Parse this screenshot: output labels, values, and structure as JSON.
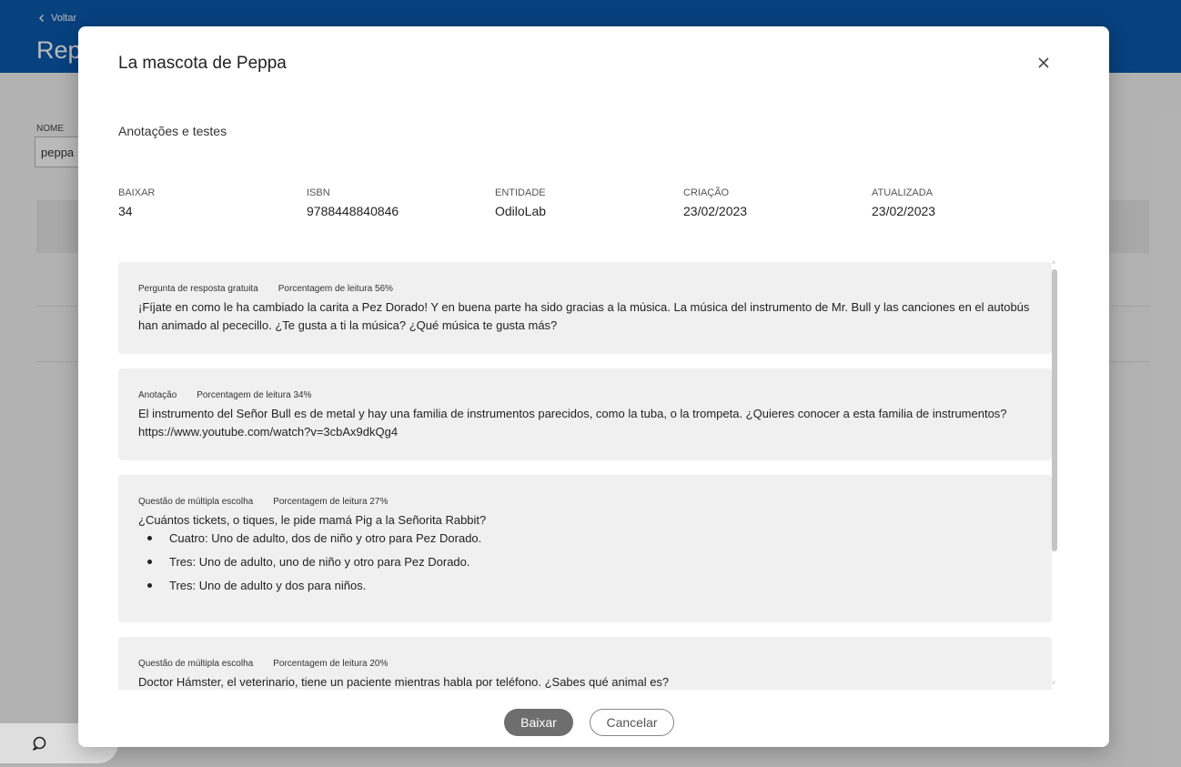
{
  "background": {
    "back_label": "Voltar",
    "page_title": "Rep",
    "name_label": "NOME",
    "name_value": "peppa"
  },
  "modal": {
    "title": "La mascota de Peppa",
    "section_title": "Anotações e testes",
    "meta": [
      {
        "label": "BAIXAR",
        "value": "34"
      },
      {
        "label": "ISBN",
        "value": "9788448840846"
      },
      {
        "label": "ENTIDADE",
        "value": "OdiloLab"
      },
      {
        "label": "CRIAÇÃO",
        "value": "23/02/2023"
      },
      {
        "label": "ATUALIZADA",
        "value": "23/02/2023"
      }
    ],
    "cards": [
      {
        "type": "Pergunta de resposta gratuita",
        "progress": "Porcentagem de leitura 56%",
        "text": "¡Fíjate en como le ha cambiado la carita a Pez Dorado! Y en buena parte ha sido gracias a la música. La música del instrumento de Mr. Bull y las canciones en el autobús han animado al pececillo. ¿Te gusta a ti la música? ¿Qué música te gusta más?"
      },
      {
        "type": "Anotação",
        "progress": "Porcentagem de leitura 34%",
        "text": "El instrumento del Señor Bull es de metal y hay una familia de instrumentos parecidos, como la tuba, o la trompeta. ¿Quieres conocer a esta familia de instrumentos? https://www.youtube.com/watch?v=3cbAx9dkQg4"
      },
      {
        "type": "Questão de múltipla escolha",
        "progress": "Porcentagem de leitura 27%",
        "text": "¿Cuántos tickets, o tiques, le pide mamá Pig a la Señorita Rabbit?",
        "options": [
          "Cuatro: Uno de adulto, dos de niño y otro para Pez Dorado.",
          "Tres: Uno de adulto, uno de niño y otro para Pez Dorado.",
          "Tres: Uno de adulto y dos para niños."
        ]
      },
      {
        "type": "Questão de múltipla escolha",
        "progress": "Porcentagem de leitura 20%",
        "text": "Doctor Hámster, el veterinario, tiene un paciente mientras habla por teléfono. ¿Sabes qué animal es?"
      }
    ],
    "download_label": "Baixar",
    "cancel_label": "Cancelar"
  },
  "icons": {
    "close": "close-icon",
    "back": "chevron-left-icon",
    "chat": "chat-bubble-icon"
  }
}
